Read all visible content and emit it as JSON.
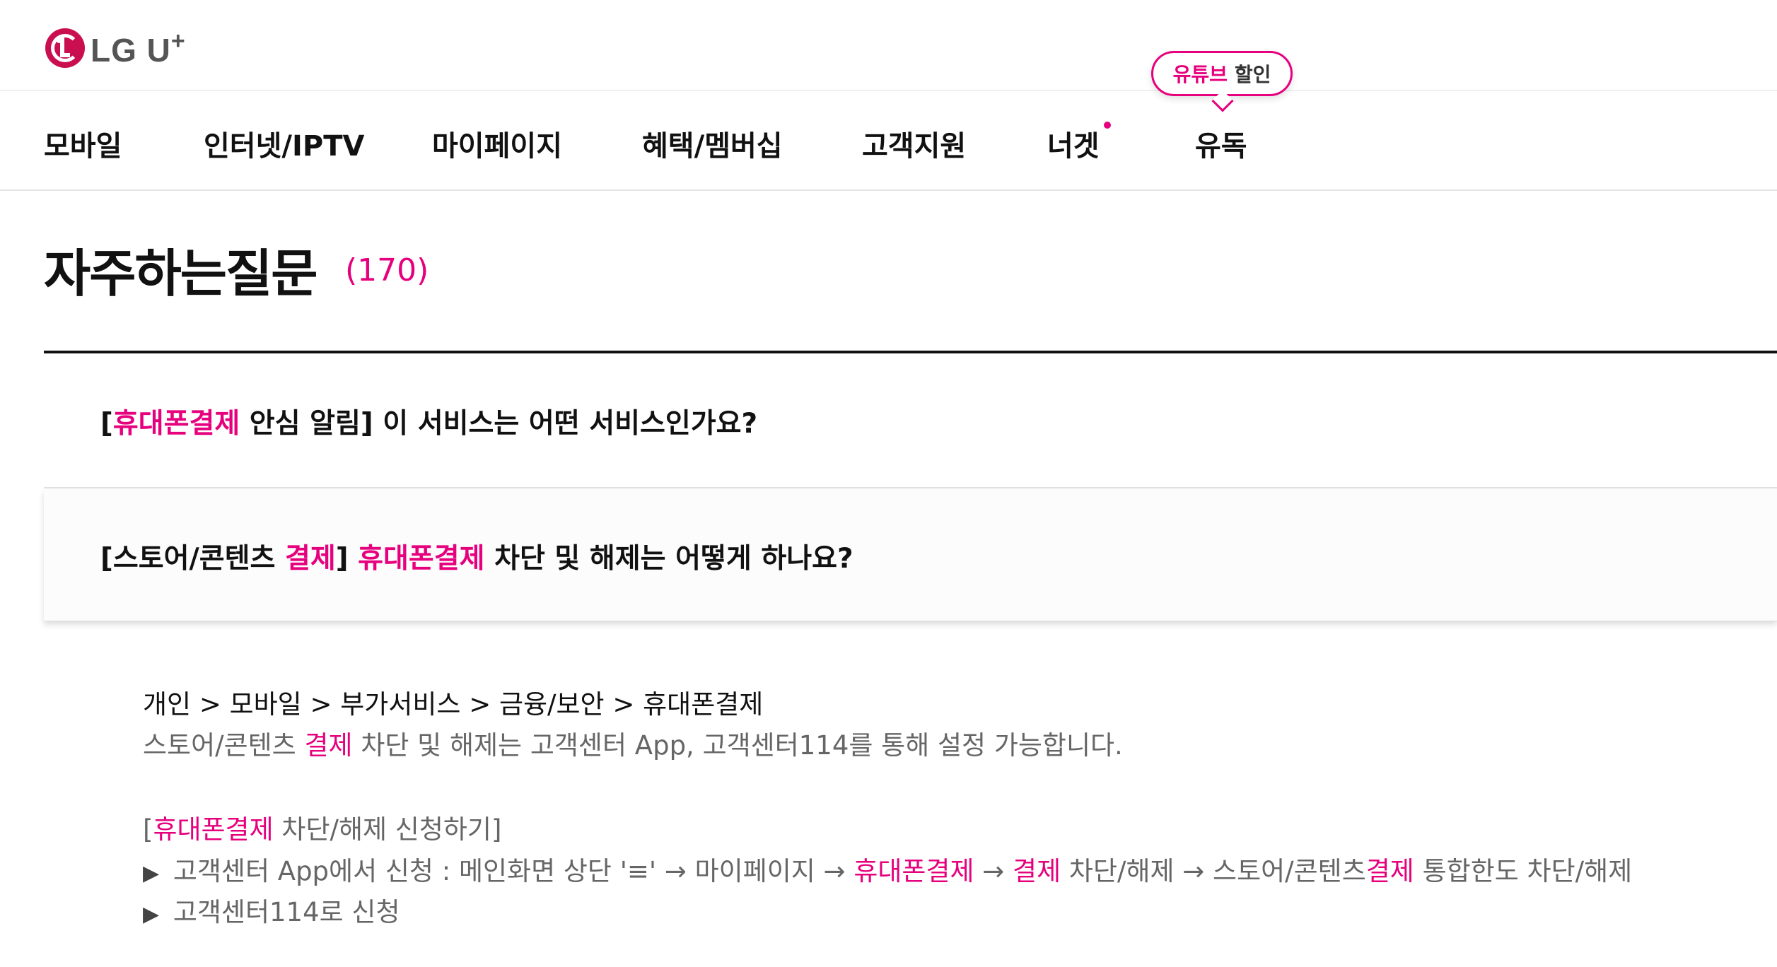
{
  "header": {
    "logo_text": "LG U",
    "logo_plus": "+"
  },
  "gnb": {
    "items": [
      "모바일",
      "인터넷/IPTV",
      "마이페이지",
      "혜택/멤버십",
      "고객지원",
      "너겟",
      "유독"
    ],
    "bubble_highlight": "유튜브",
    "bubble_text": "할인"
  },
  "page": {
    "title": "자주하는질문",
    "count": "(170)"
  },
  "faq": [
    {
      "open": false,
      "parts": [
        {
          "t": "[",
          "hl": false
        },
        {
          "t": "휴대폰결제",
          "hl": true
        },
        {
          "t": " 안심 알림] 이 서비스는 어떤 서비스인가요?",
          "hl": false
        }
      ]
    },
    {
      "open": true,
      "parts": [
        {
          "t": "[스토어/콘텐츠 ",
          "hl": false
        },
        {
          "t": "결제",
          "hl": true
        },
        {
          "t": "] ",
          "hl": false
        },
        {
          "t": "휴대폰결제",
          "hl": true
        },
        {
          "t": " 차단 및 해제는 어떻게 하나요?",
          "hl": false
        }
      ]
    }
  ],
  "answer": {
    "path": "개인 > 모바일 > 부가서비스 > 금융/보안 > 휴대폰결제",
    "line1": [
      {
        "t": "스토어/콘텐츠 ",
        "hl": false
      },
      {
        "t": "결제",
        "hl": true
      },
      {
        "t": " 차단 및 해제는 고객센터 App, 고객센터114를 통해 설정 가능합니다.",
        "hl": false
      }
    ],
    "line2": [
      {
        "t": "[",
        "hl": false
      },
      {
        "t": "휴대폰결제",
        "hl": true
      },
      {
        "t": " 차단/해제 신청하기]",
        "hl": false
      }
    ],
    "bullet_marker": "▶",
    "line3": [
      {
        "t": " 고객센터 App에서 신청 : 메인화면 상단 '≡' → 마이페이지 → ",
        "hl": false
      },
      {
        "t": "휴대폰결제",
        "hl": true
      },
      {
        "t": " → ",
        "hl": false
      },
      {
        "t": "결제",
        "hl": true
      },
      {
        "t": " 차단/해제 → 스토어/콘텐츠",
        "hl": false
      },
      {
        "t": "결제",
        "hl": true
      },
      {
        "t": " 통합한도 차단/해제",
        "hl": false
      }
    ],
    "line4": [
      {
        "t": " 고객센터114로 신청",
        "hl": false
      }
    ]
  },
  "colors": {
    "accent": "#e6007e",
    "logo_red": "#c90f50"
  }
}
